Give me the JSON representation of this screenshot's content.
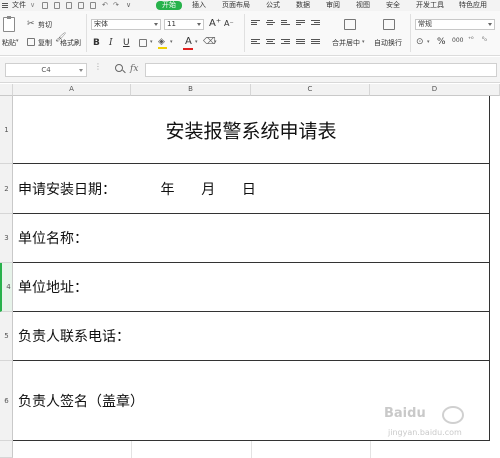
{
  "menu": {
    "items": [
      "文件",
      "开始",
      "插入",
      "页面布局",
      "公式",
      "数据",
      "审阅",
      "视图",
      "安全",
      "开发工具",
      "特色应用"
    ],
    "active": "开始"
  },
  "ribbon": {
    "cut": "剪切",
    "paste": "粘贴",
    "copy": "复制",
    "format_painter": "格式刷",
    "font_name": "宋体",
    "font_size": "11",
    "bold": "B",
    "italic": "I",
    "underline": "U",
    "font_grow": "A⁺",
    "font_shrink": "A⁻",
    "merge_center": "合并居中",
    "wrap_text": "自动换行",
    "number_format": "常规",
    "percent": "%"
  },
  "formula_bar": {
    "cell_ref": "C4",
    "fx": "fx",
    "formula": ""
  },
  "columns": [
    "A",
    "B",
    "C",
    "D"
  ],
  "rows": [
    {
      "num": "1",
      "text": "安装报警系统申请表"
    },
    {
      "num": "2",
      "text": "申请安装日期：          年      月      日"
    },
    {
      "num": "3",
      "text": "单位名称："
    },
    {
      "num": "4",
      "text": "单位地址："
    },
    {
      "num": "5",
      "text": "负责人联系电话："
    },
    {
      "num": "6",
      "text": "负责人签名（盖章）"
    }
  ],
  "watermark": {
    "brand": "Baidu",
    "sub": "jingyan.baidu.com"
  },
  "colors": {
    "accent": "#27b24b",
    "border": "#333333"
  }
}
